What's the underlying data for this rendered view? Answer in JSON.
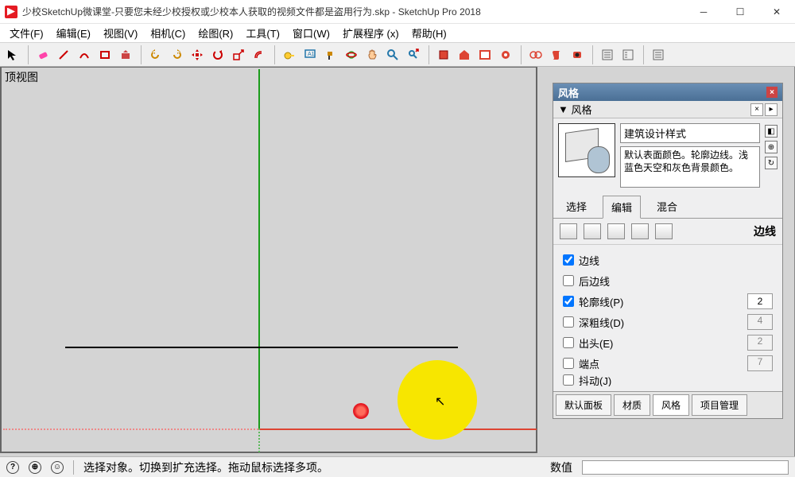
{
  "titlebar": {
    "title": "少校SketchUp微课堂-只要您未经少校授权或少校本人获取的视频文件都是盗用行为.skp - SketchUp Pro 2018"
  },
  "menus": [
    "文件(F)",
    "编辑(E)",
    "视图(V)",
    "相机(C)",
    "绘图(R)",
    "工具(T)",
    "窗口(W)",
    "扩展程序 (x)",
    "帮助(H)"
  ],
  "viewport": {
    "label": "顶视图"
  },
  "tray": {
    "title": "风格",
    "panel": "风格",
    "style_name": "建筑设计样式",
    "style_desc": "默认表面颜色。轮廓边线。浅蓝色天空和灰色背景颜色。",
    "tabs": [
      "选择",
      "编辑",
      "混合"
    ],
    "edge_section_label": "边线",
    "checks": {
      "edges": {
        "label": "边线",
        "checked": true
      },
      "back_edges": {
        "label": "后边线",
        "checked": false
      },
      "profiles": {
        "label": "轮廓线(P)",
        "checked": true,
        "value": "2"
      },
      "depth": {
        "label": "深粗线(D)",
        "checked": false,
        "value": "4"
      },
      "extension": {
        "label": "出头(E)",
        "checked": false,
        "value": "2"
      },
      "endpoints": {
        "label": "端点",
        "checked": false,
        "value": "7"
      },
      "jitter": {
        "label": "抖动(J)",
        "checked": false
      }
    },
    "bottom_tabs": [
      "默认面板",
      "材质",
      "风格",
      "项目管理"
    ]
  },
  "status": {
    "hint": "选择对象。切换到扩充选择。拖动鼠标选择多项。",
    "vcb_label": "数值"
  }
}
